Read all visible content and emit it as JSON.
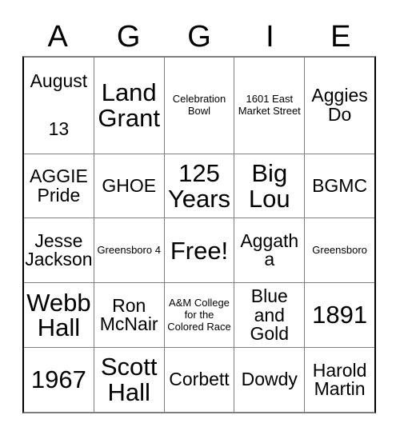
{
  "card": {
    "title_letters": [
      "A",
      "G",
      "G",
      "I",
      "E"
    ],
    "free_space_label": "Free!",
    "grid_border_color": "#000000",
    "text_color": "#000000",
    "background_color": "#ffffff",
    "rows": [
      [
        {
          "text": "August 13",
          "size": "spread"
        },
        {
          "text": "Land Grant",
          "size": "xl"
        },
        {
          "text": "Celebration Bowl",
          "size": "xs"
        },
        {
          "text": "1601 East Market Street",
          "size": "xs"
        },
        {
          "text": "Aggies Do",
          "size": "md"
        }
      ],
      [
        {
          "text": "AGGIE Pride",
          "size": "md"
        },
        {
          "text": "GHOE",
          "size": "md"
        },
        {
          "text": "125 Years",
          "size": "xl"
        },
        {
          "text": "Big Lou",
          "size": "xl"
        },
        {
          "text": "BGMC",
          "size": "md"
        }
      ],
      [
        {
          "text": "Jesse Jackson",
          "size": "md"
        },
        {
          "text": "Greensboro 4",
          "size": "xs"
        },
        {
          "text": "Free!",
          "size": "xl"
        },
        {
          "text": "Aggatha",
          "size": "md"
        },
        {
          "text": "Greensboro",
          "size": "xs"
        }
      ],
      [
        {
          "text": "Webb Hall",
          "size": "xl"
        },
        {
          "text": "Ron McNair",
          "size": "md"
        },
        {
          "text": "A&M College for the Colored Race",
          "size": "xs"
        },
        {
          "text": "Blue and Gold",
          "size": "md"
        },
        {
          "text": "1891",
          "size": "xl"
        }
      ],
      [
        {
          "text": "1967",
          "size": "xl"
        },
        {
          "text": "Scott Hall",
          "size": "xl"
        },
        {
          "text": "Corbett",
          "size": "md"
        },
        {
          "text": "Dowdy",
          "size": "md"
        },
        {
          "text": "Harold Martin",
          "size": "md"
        }
      ]
    ]
  }
}
